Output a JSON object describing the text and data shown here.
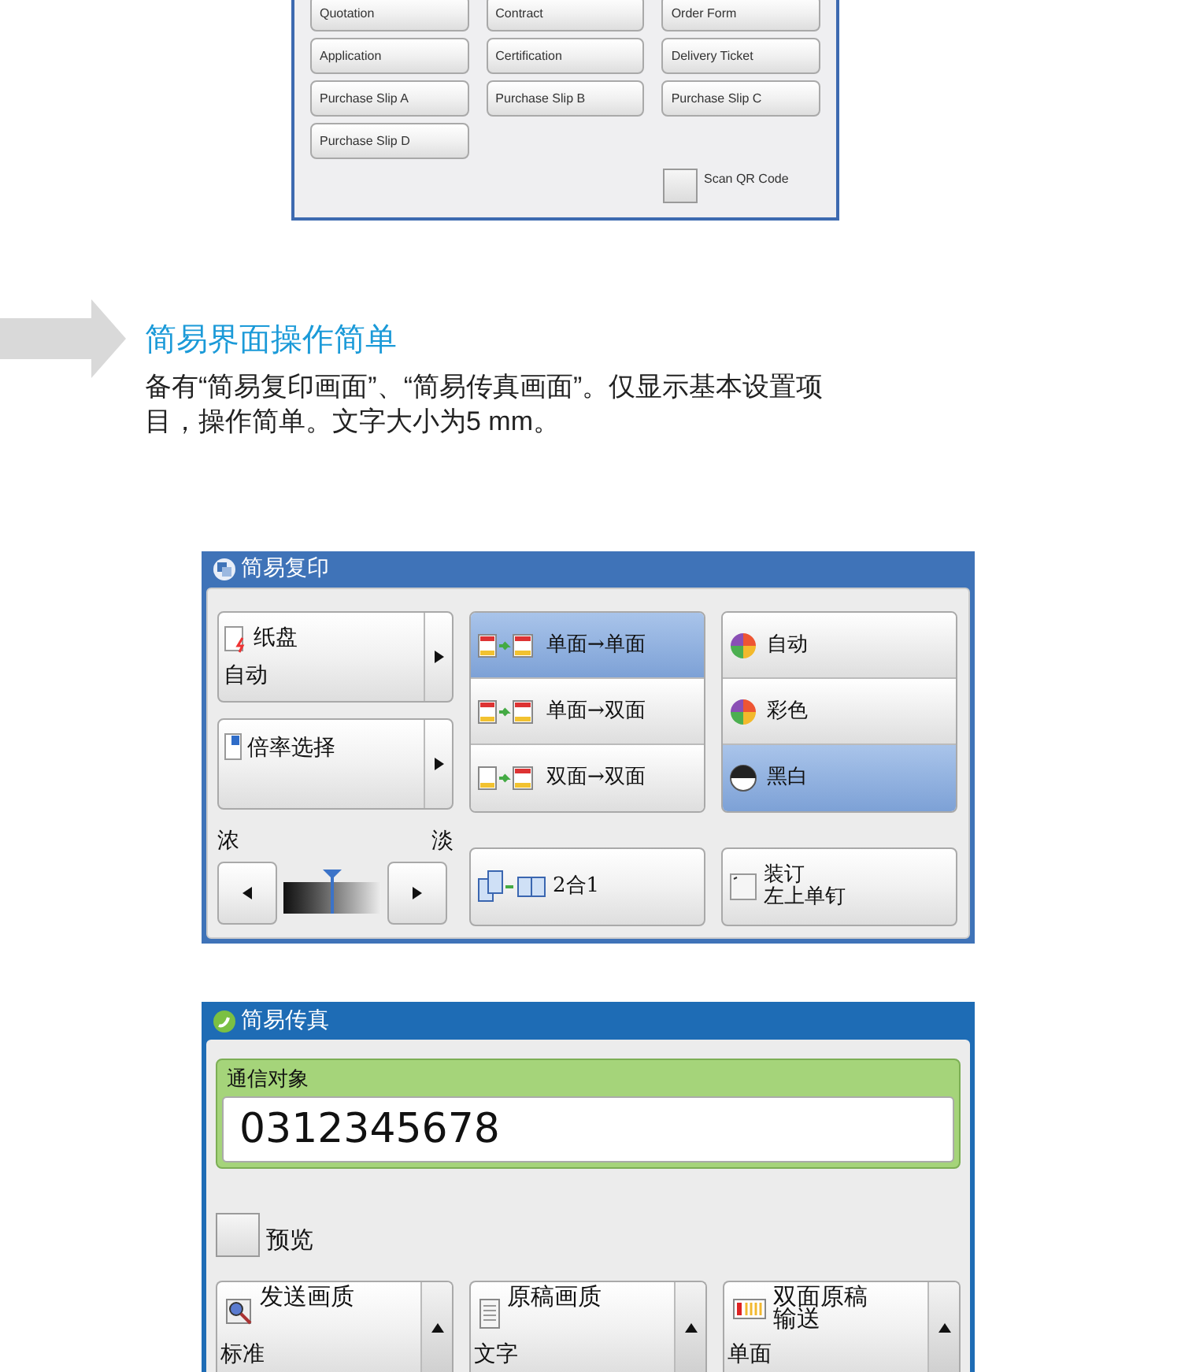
{
  "document_screen": {
    "buttons": [
      {
        "label": "Quotation"
      },
      {
        "label": "Contract"
      },
      {
        "label": "Order Form"
      },
      {
        "label": "Application"
      },
      {
        "label": "Certification"
      },
      {
        "label": "Delivery Ticket"
      },
      {
        "label": "Purchase Slip A"
      },
      {
        "label": "Purchase Slip B"
      },
      {
        "label": "Purchase Slip C"
      },
      {
        "label": "Purchase Slip D"
      }
    ],
    "scan_qr_code": {
      "label": "Scan QR Code",
      "checked": false
    }
  },
  "feature": {
    "heading": "简易界面操作简单",
    "description": "备有“简易复印画面”、“简易传真画面”。仅显示基本设置项目，操作简单。文字大小为5 mm。"
  },
  "simple_copy": {
    "title": "简易复印",
    "paper_tray": {
      "label": "纸盘",
      "value": "自动"
    },
    "magnification": {
      "label": "倍率选择"
    },
    "density": {
      "dark_label": "浓",
      "light_label": "淡",
      "level": 0.5
    },
    "sides": [
      {
        "label": "单面→单面",
        "selected": true
      },
      {
        "label": "单面→双面",
        "selected": false
      },
      {
        "label": "双面→双面",
        "selected": false
      }
    ],
    "color_modes": [
      {
        "label": "自动",
        "selected": false
      },
      {
        "label": "彩色",
        "selected": false
      },
      {
        "label": "黑白",
        "selected": true
      }
    ],
    "n_up": {
      "label": "2合1"
    },
    "staple": {
      "lines": [
        "装订",
        "左上单钉"
      ]
    }
  },
  "simple_fax": {
    "title": "简易传真",
    "recipient": {
      "label": "通信对象",
      "value": "0312345678"
    },
    "preview": {
      "label": "预览",
      "checked": false
    },
    "settings": [
      {
        "lines": [
          "发送画质"
        ],
        "value": "标准"
      },
      {
        "lines": [
          "原稿画质"
        ],
        "value": "文字"
      },
      {
        "lines": [
          "双面原稿",
          "输送"
        ],
        "value": "单面"
      }
    ]
  }
}
